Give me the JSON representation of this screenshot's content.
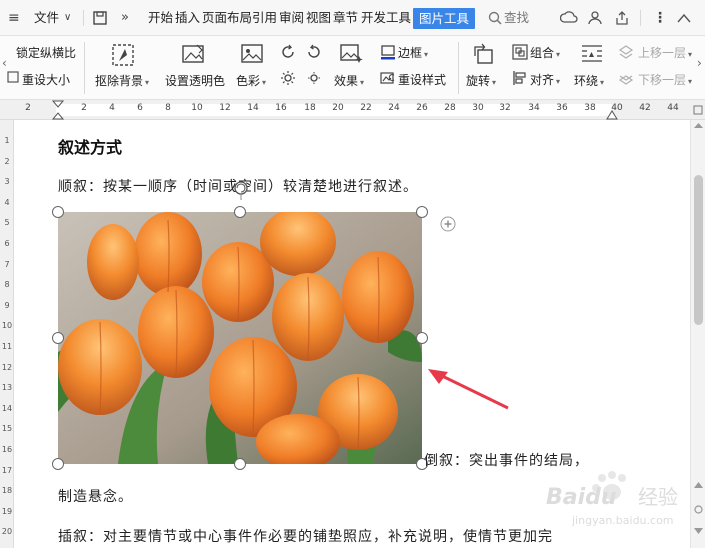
{
  "menubar": {
    "file_menu": "文件",
    "tabs": [
      "开始",
      "插入",
      "页面布局",
      "引用",
      "审阅",
      "视图",
      "章节",
      "开发工具"
    ],
    "active_tab": "图片工具",
    "search_label": "查找"
  },
  "ribbon": {
    "lock_ratio": "锁定纵横比",
    "reset_size": "重设大小",
    "remove_bg": "抠除背景",
    "set_transparent": "设置透明色",
    "color": "色彩",
    "effect": "效果",
    "border": "边框",
    "reset_style": "重设样式",
    "rotate": "旋转",
    "group": "组合",
    "align": "对齐",
    "wrap": "环绕",
    "bring_forward": "上移一层",
    "send_backward": "下移一层"
  },
  "ruler": {
    "h_labels": [
      "2",
      "2",
      "4",
      "6",
      "8",
      "10",
      "12",
      "14",
      "16",
      "18",
      "20",
      "22",
      "24",
      "26",
      "28",
      "30",
      "32",
      "34",
      "36",
      "38",
      "40",
      "42",
      "44"
    ],
    "v_labels": [
      "1",
      "2",
      "3",
      "4",
      "5",
      "6",
      "7",
      "8",
      "9",
      "10",
      "11",
      "12",
      "13",
      "14",
      "15",
      "16",
      "17",
      "18",
      "19",
      "20"
    ]
  },
  "document": {
    "heading": "叙述方式",
    "para1": "顺叙：按某一顺序（时间或空间）较清楚地进行叙述。",
    "para2_inline": "倒叙：突出事件的结局，",
    "para2_cont": "制造悬念。",
    "para3": "插叙：对主要情节或中心事件作必要的铺垫照应，补充说明，使情节更加完"
  },
  "watermark": {
    "brand": "Baidu",
    "sub": "经验",
    "url": "jingyan.baidu.com"
  },
  "colors": {
    "accent": "#3a86e8",
    "arrow": "#e8394a"
  }
}
